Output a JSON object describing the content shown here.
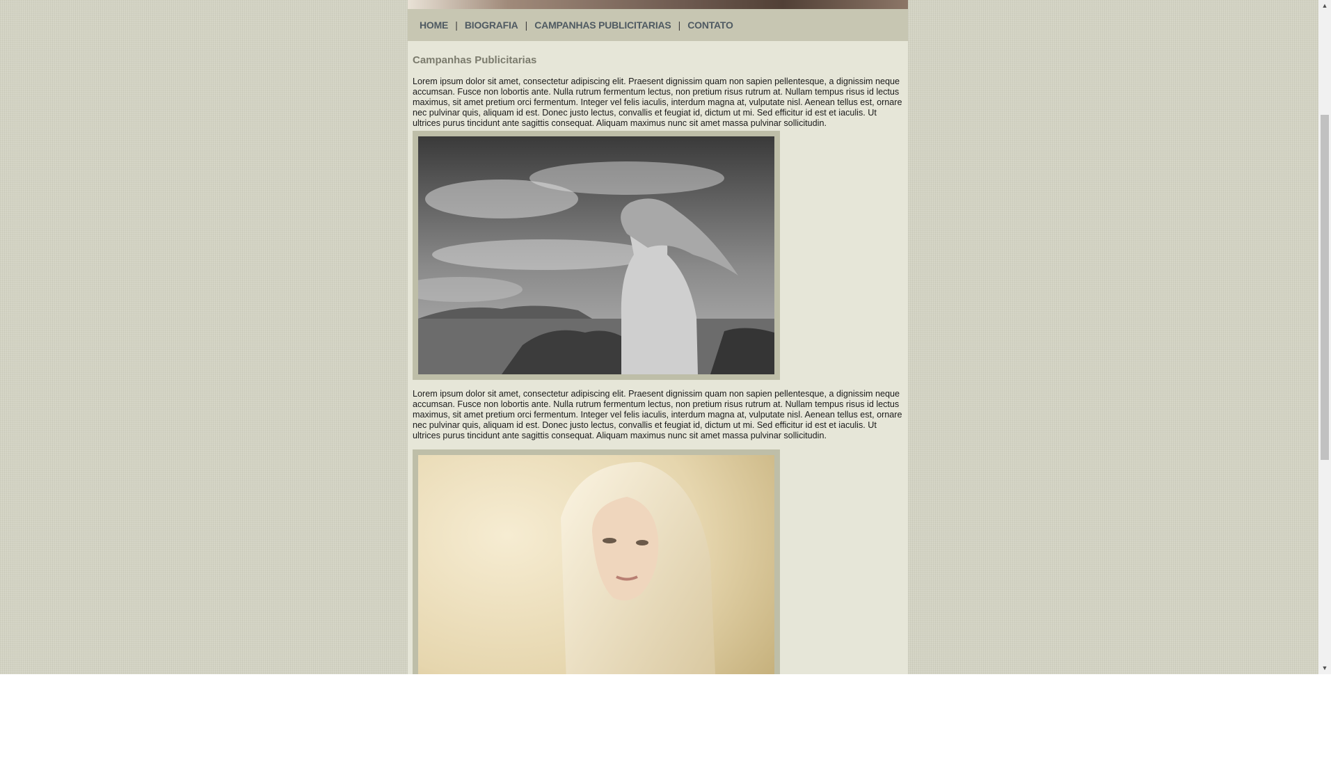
{
  "nav": {
    "items": [
      {
        "label": "HOME"
      },
      {
        "label": "BIOGRAFIA"
      },
      {
        "label": "CAMPANHAS PUBLICITARIAS"
      },
      {
        "label": "CONTATO"
      }
    ],
    "separator": "|"
  },
  "main": {
    "title": "Campanhas Publicitarias",
    "paragraph_1": "Lorem ipsum dolor sit amet, consectetur adipiscing elit. Praesent dignissim quam non sapien pellentesque, a dignissim neque accumsan. Fusce non lobortis ante. Nulla rutrum fermentum lectus, non pretium risus rutrum at. Nullam tempus risus id lectus maximus, sit amet pretium orci fermentum. Integer vel felis iaculis, interdum magna at, vulputate nisl. Aenean tellus est, ornare nec pulvinar quis, aliquam id est. Donec justo lectus, convallis et feugiat id, dictum ut mi. Sed efficitur id est et iaculis. Ut ultrices purus tincidunt ante sagittis consequat. Aliquam maximus nunc sit amet massa pulvinar sollicitudin.",
    "paragraph_2": "Lorem ipsum dolor sit amet, consectetur adipiscing elit. Praesent dignissim quam non sapien pellentesque, a dignissim neque accumsan. Fusce non lobortis ante. Nulla rutrum fermentum lectus, non pretium risus rutrum at. Nullam tempus risus id lectus maximus, sit amet pretium orci fermentum. Integer vel felis iaculis, interdum magna at, vulputate nisl. Aenean tellus est, ornare nec pulvinar quis, aliquam id est. Donec justo lectus, convallis et feugiat id, dictum ut mi. Sed efficitur id est et iaculis. Ut ultrices purus tincidunt ante sagittis consequat. Aliquam maximus nunc sit amet massa pulvinar sollicitudin."
  },
  "icons": {
    "scroll_up": "triangle-up-icon",
    "scroll_down": "triangle-down-icon"
  },
  "colors": {
    "background": "#d3d3c3",
    "page": "#e6e6d8",
    "nav_bar": "#c7c6b2",
    "nav_text": "#4f5a62",
    "title_text": "#7b7b6d",
    "photo_frame": "#bebea8"
  }
}
